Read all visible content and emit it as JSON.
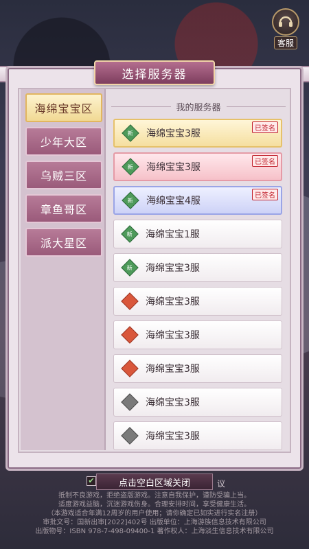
{
  "service": {
    "label": "客服",
    "icon": "customer-service-icon"
  },
  "dialog": {
    "title": "选择服务器"
  },
  "zones": [
    {
      "label": "海绵宝宝区",
      "active": true
    },
    {
      "label": "少年大区",
      "active": false
    },
    {
      "label": "乌贼三区",
      "active": false
    },
    {
      "label": "章鱼哥区",
      "active": false
    },
    {
      "label": "派大星区",
      "active": false
    }
  ],
  "my_servers_header": "我的服务器",
  "servers": [
    {
      "name": "海绵宝宝3服",
      "badge": "新",
      "status": "new",
      "style": "gold",
      "tag": "已签名"
    },
    {
      "name": "海绵宝宝3服",
      "badge": "新",
      "status": "new",
      "style": "pink",
      "tag": "已签名"
    },
    {
      "name": "海绵宝宝4服",
      "badge": "新",
      "status": "new",
      "style": "blue",
      "tag": "已签名"
    },
    {
      "name": "海绵宝宝1服",
      "badge": "新",
      "status": "new",
      "style": "plain",
      "tag": ""
    },
    {
      "name": "海绵宝宝3服",
      "badge": "新",
      "status": "new",
      "style": "plain",
      "tag": ""
    },
    {
      "name": "海绵宝宝3服",
      "badge": "",
      "status": "hot",
      "style": "plain",
      "tag": ""
    },
    {
      "name": "海绵宝宝3服",
      "badge": "",
      "status": "hot",
      "style": "plain",
      "tag": ""
    },
    {
      "name": "海绵宝宝3服",
      "badge": "",
      "status": "hot",
      "style": "plain",
      "tag": ""
    },
    {
      "name": "海绵宝宝3服",
      "badge": "",
      "status": "off",
      "style": "plain",
      "tag": ""
    },
    {
      "name": "海绵宝宝3服",
      "badge": "",
      "status": "off",
      "style": "plain",
      "tag": ""
    }
  ],
  "close_hint": "点击空白区域关闭",
  "agreement_suffix": "议",
  "footer_lines": [
    "抵制不良游戏，拒绝盗版游戏。注意自我保护，谨防受骗上当。",
    "适度游戏益脑，沉迷游戏伤身。合理安排时间，享受健康生活。",
    "（本游戏适合年满12周岁的用户使用；请你确定已如实进行实名注册）",
    "审批文号：国新出审[2022]402号  出版单位：上海游族信息技术有限公司",
    "出版物号：ISBN 978-7-498-09400-1  著作权人：上海淡生信息技术有限公司"
  ],
  "colors": {
    "badge_new": "#4e9a5a",
    "badge_hot": "#d9573b",
    "badge_off": "#7a7a7a",
    "zone_active": "#f1d994",
    "zone_inactive": "#9a5a7a"
  }
}
